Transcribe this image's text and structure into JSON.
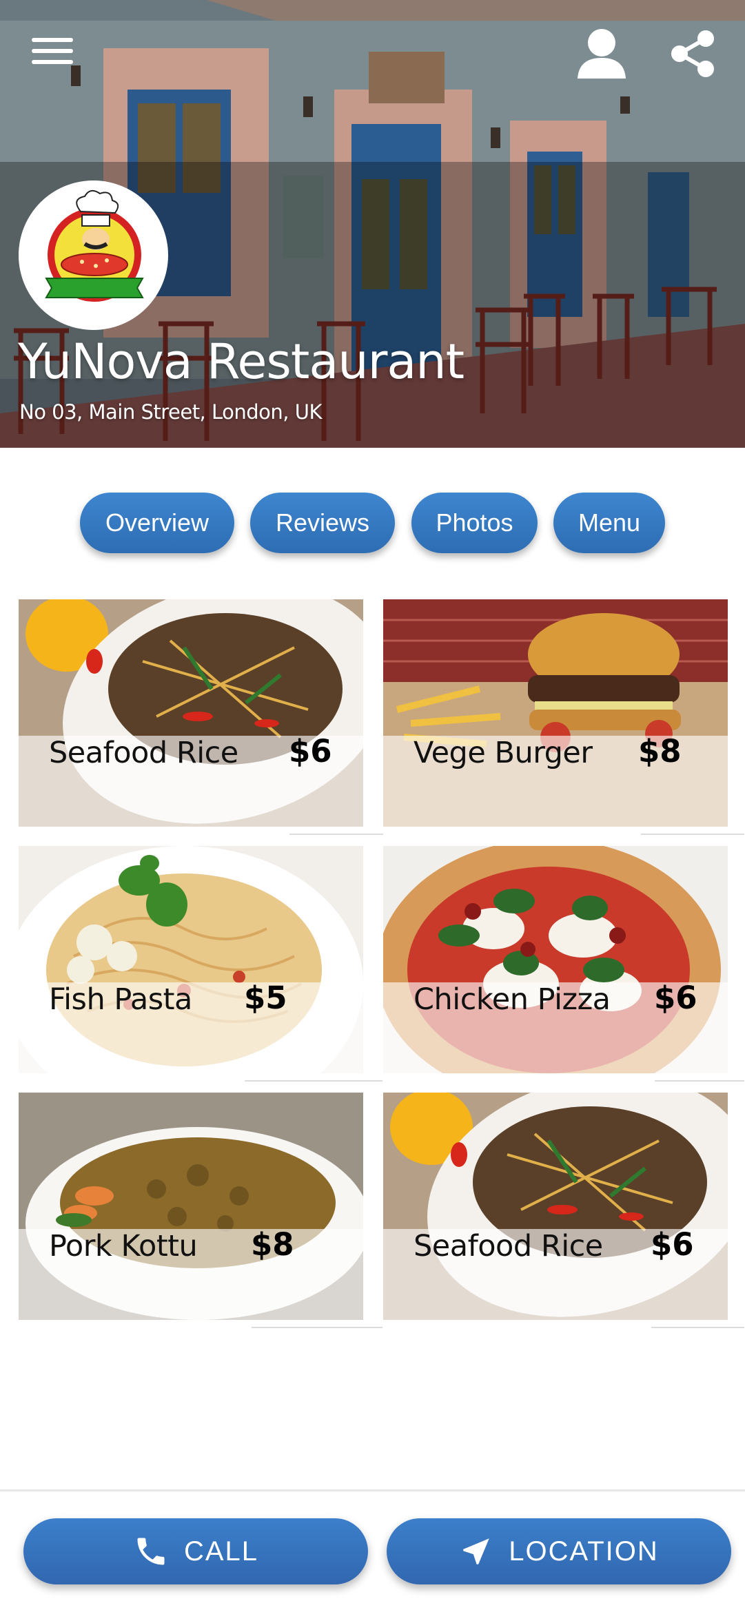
{
  "header": {
    "menu_icon": "hamburger-menu-icon",
    "profile_icon": "user-profile-icon",
    "share_icon": "share-icon"
  },
  "restaurant": {
    "name": "YuNova Restaurant",
    "address": "No 03, Main Street, London, UK",
    "logo": "chef-pizza-logo"
  },
  "tabs": [
    {
      "label": "Overview"
    },
    {
      "label": "Reviews"
    },
    {
      "label": "Photos"
    },
    {
      "label": "Menu"
    }
  ],
  "menu_items": [
    {
      "name": "Seafood Rice",
      "price": "$6"
    },
    {
      "name": "Vege Burger",
      "price": "$8"
    },
    {
      "name": "Fish Pasta",
      "price": "$5"
    },
    {
      "name": "Chicken Pizza",
      "price": "$6"
    },
    {
      "name": "Pork Kottu",
      "price": "$8"
    },
    {
      "name": "Seafood Rice",
      "price": "$6"
    }
  ],
  "actions": {
    "call_label": "CALL",
    "call_icon": "phone-icon",
    "location_label": "LOCATION",
    "location_icon": "navigation-arrow-icon"
  },
  "colors": {
    "accent": "#3478c3",
    "text_on_accent": "#ffffff"
  }
}
